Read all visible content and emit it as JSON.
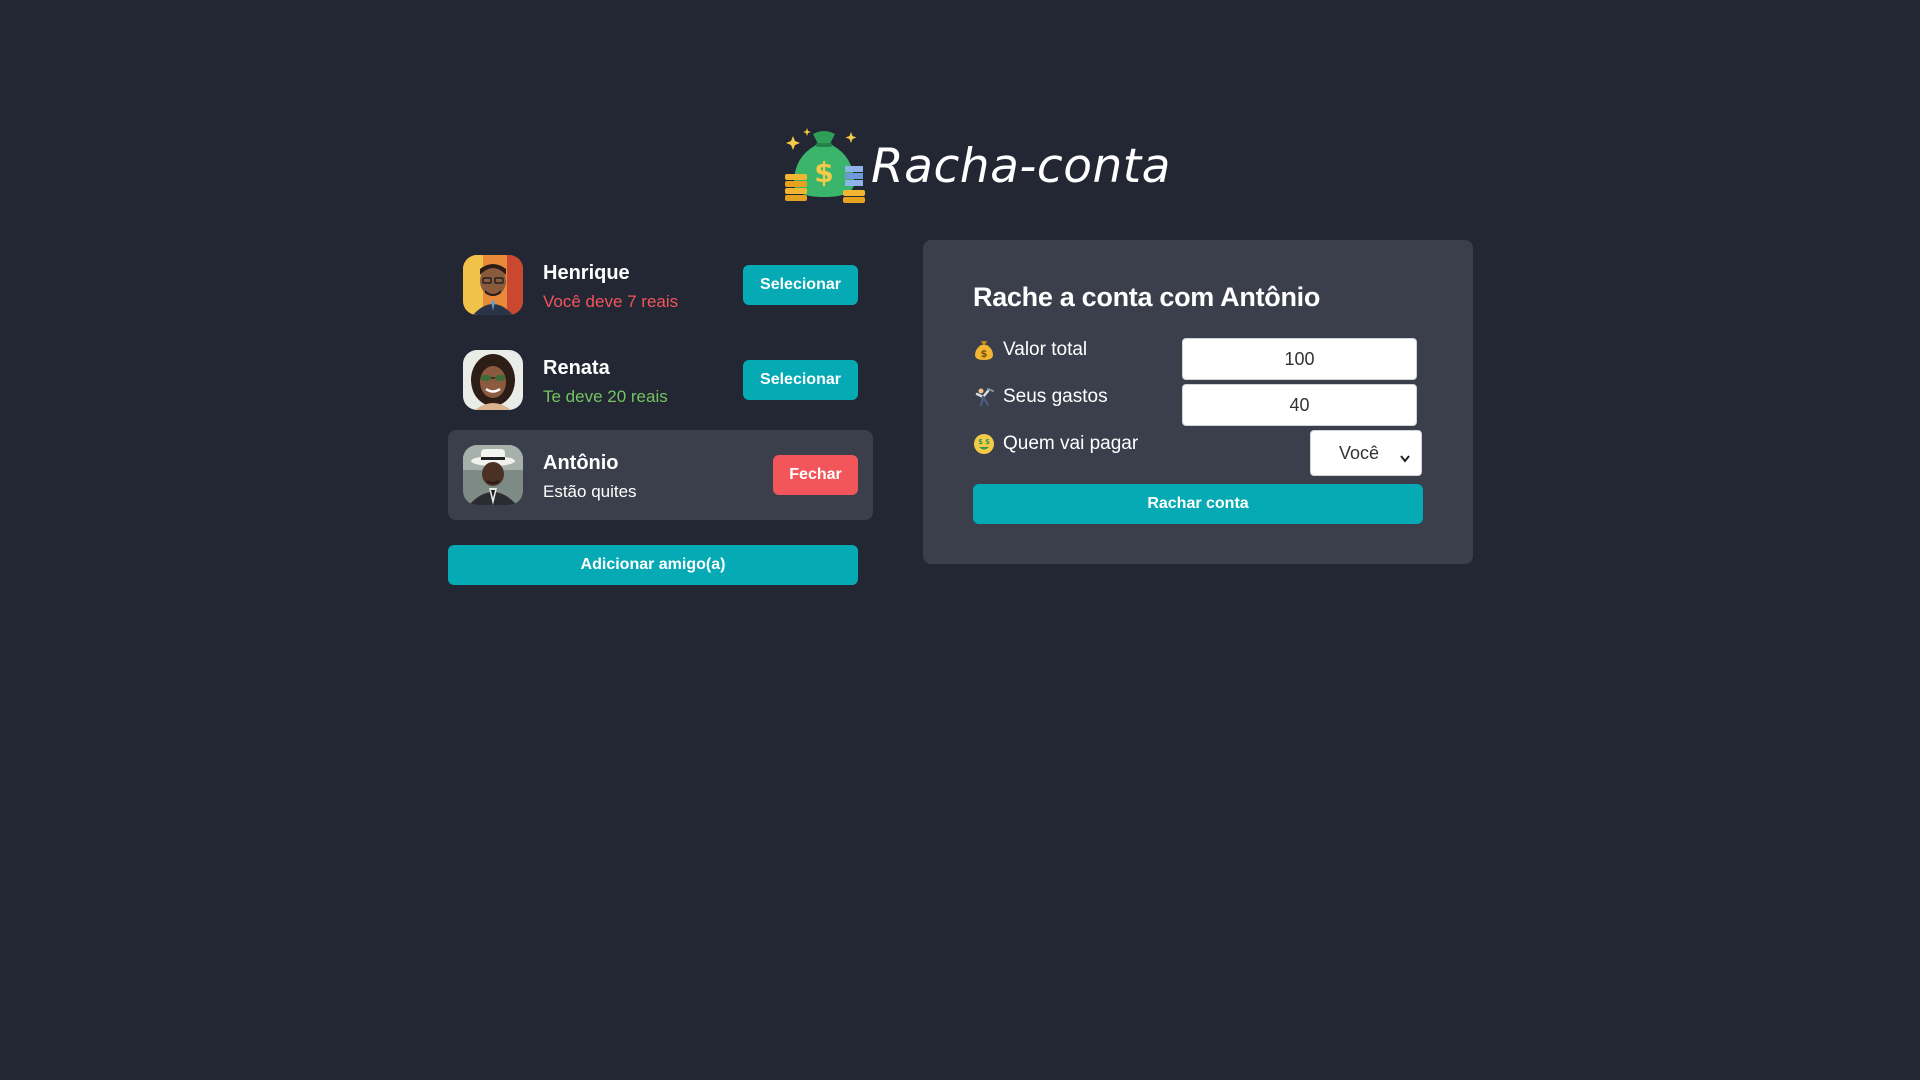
{
  "app": {
    "title": "Racha-conta",
    "logo_icon": "money-bag-icon"
  },
  "friends": [
    {
      "name": "Henrique",
      "status": "Você deve 7 reais",
      "status_type": "negative",
      "button_label": "Selecionar",
      "selected": false
    },
    {
      "name": "Renata",
      "status": "Te deve 20 reais",
      "status_type": "positive",
      "button_label": "Selecionar",
      "selected": false
    },
    {
      "name": "Antônio",
      "status": "Estão quites",
      "status_type": "neutral",
      "button_label": "Fechar",
      "selected": true
    }
  ],
  "add_friend_label": "Adicionar amigo(a)",
  "split_form": {
    "title": "Rache a conta com Antônio",
    "total_label": "Valor total",
    "total_icon": "money-bag-icon",
    "total_value": "100",
    "expenses_label": "Seus gastos",
    "expenses_icon": "person-lifting-icon",
    "expenses_value": "40",
    "payer_label": "Quem vai pagar",
    "payer_icon": "money-face-icon",
    "payer_value": "Você",
    "submit_label": "Rachar conta"
  },
  "colors": {
    "background": "#222733",
    "panel": "#3b3f4c",
    "accent": "#05aab5",
    "danger": "#f2555a",
    "positive": "#74c45f"
  }
}
